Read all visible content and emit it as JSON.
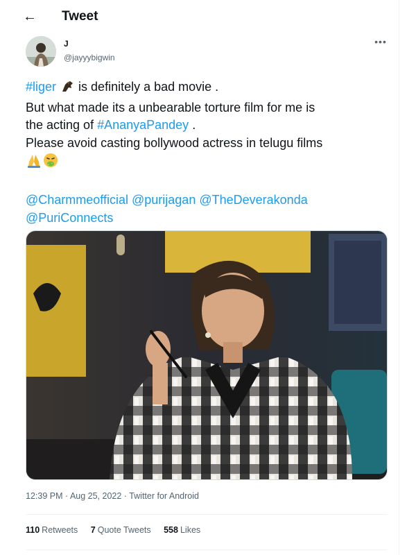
{
  "header": {
    "title": "Tweet",
    "back_icon": "arrow-left-icon"
  },
  "author": {
    "name": "J",
    "handle": "@jayyybigwin"
  },
  "more_label": "•••",
  "tweet": {
    "line1_tag": "#liger",
    "line1_rest": " is definitely a bad movie .",
    "line2": "But what made its a unbearable torture film for me is",
    "line3_pre": "the acting of ",
    "line3_tag": "#AnanyaPandey",
    "line3_post": " .",
    "line4": "Please avoid casting bollywood actress in telugu films",
    "emoji_icons": [
      "folded-hands-icon",
      "vomiting-face-icon"
    ],
    "mentions": [
      "@Charmmeofficial",
      "@purijagan",
      "@TheDeverakonda",
      "@PuriConnects"
    ]
  },
  "meta": {
    "time": "12:39 PM",
    "sep1": " · ",
    "date": "Aug 25, 2022",
    "sep2": " · ",
    "source": "Twitter for Android"
  },
  "stats": {
    "retweets_count": "110",
    "retweets_label": "Retweets",
    "quotes_count": "7",
    "quotes_label": "Quote Tweets",
    "likes_count": "558",
    "likes_label": "Likes"
  },
  "colors": {
    "link": "#1d9bf0",
    "text": "#0f1419",
    "secondary": "#536471",
    "border": "#eff3f4"
  }
}
